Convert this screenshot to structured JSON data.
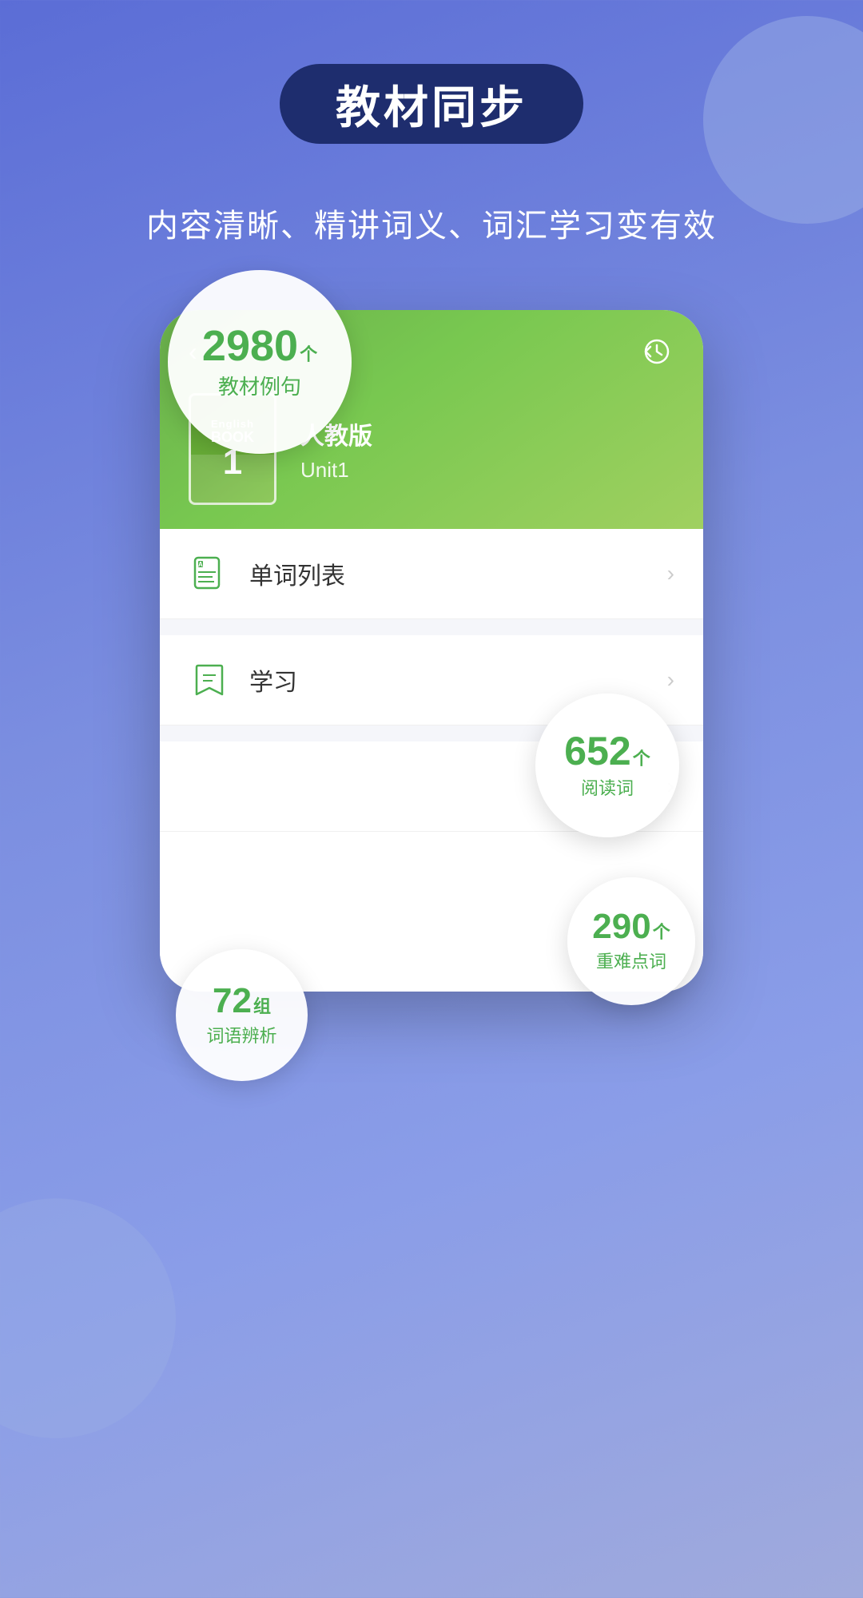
{
  "background": {
    "gradient_start": "#5b6dd6",
    "gradient_end": "#a0aadc"
  },
  "header": {
    "pill_text": "教材同步",
    "subtitle": "内容清晰、精讲词义、词汇学习变有效"
  },
  "book": {
    "cover_english": "English",
    "cover_book": "BOOK",
    "cover_number": "1",
    "publisher": "人教版",
    "unit": "Unit1"
  },
  "nav": {
    "back_icon": "‹",
    "history_icon": "🕐"
  },
  "menu_items": [
    {
      "id": "word-list",
      "icon": "abc",
      "label": "单词列表",
      "has_arrow": true
    },
    {
      "id": "study",
      "icon": "bookmark",
      "label": "学习",
      "has_arrow": true
    },
    {
      "id": "item3",
      "icon": "",
      "label": "",
      "has_arrow": true
    }
  ],
  "badges": {
    "reading_words": {
      "number": "652",
      "unit": "个",
      "label": "阅读词"
    },
    "key_words": {
      "number": "290",
      "unit": "个",
      "label": "重难点词"
    },
    "word_groups": {
      "number": "72",
      "unit": "组",
      "label": "词语辨析"
    },
    "example_sentences": {
      "number": "2980",
      "unit": "个",
      "label": "教材例句"
    }
  }
}
